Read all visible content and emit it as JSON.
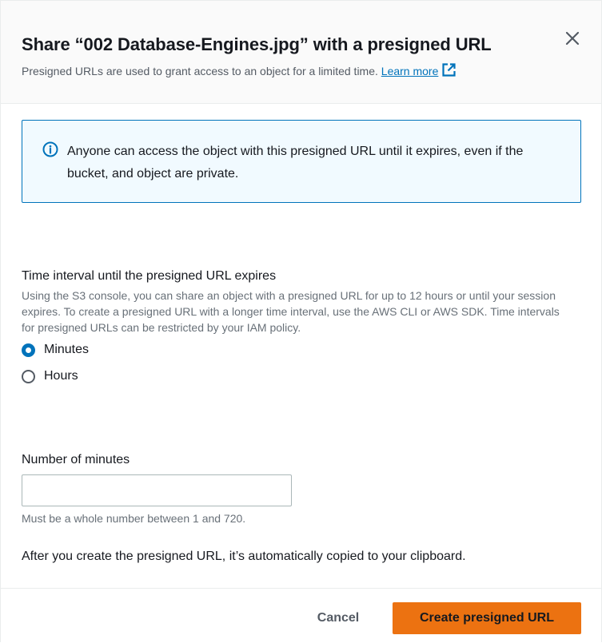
{
  "modal": {
    "title": "Share “002 Database-Engines.jpg” with a presigned URL",
    "subtitle": "Presigned URLs are used to grant access to an object for a limited time.",
    "learn_more": "Learn more",
    "close_icon": "close-icon",
    "external_icon": "external-link-icon"
  },
  "alert": {
    "icon": "info-icon",
    "text": "Anyone can access the object with this presigned URL until it expires, even if the bucket, and object are private."
  },
  "interval": {
    "label": "Time interval until the presigned URL expires",
    "description": "Using the S3 console, you can share an object with a presigned URL for up to 12 hours or until your session expires. To create a presigned URL with a longer time interval, use the AWS CLI or AWS SDK. Time intervals for presigned URLs can be restricted by your IAM policy.",
    "options": [
      {
        "label": "Minutes",
        "selected": true
      },
      {
        "label": "Hours",
        "selected": false
      }
    ]
  },
  "minutes": {
    "label": "Number of minutes",
    "value": "",
    "placeholder": "",
    "hint": "Must be a whole number between 1 and 720."
  },
  "note": "After you create the presigned URL, it’s automatically copied to your clipboard.",
  "footer": {
    "cancel_label": "Cancel",
    "create_label": "Create presigned URL"
  },
  "colors": {
    "accent": "#0073bb",
    "primary_button": "#ec7211",
    "alert_background": "#f1faff"
  }
}
